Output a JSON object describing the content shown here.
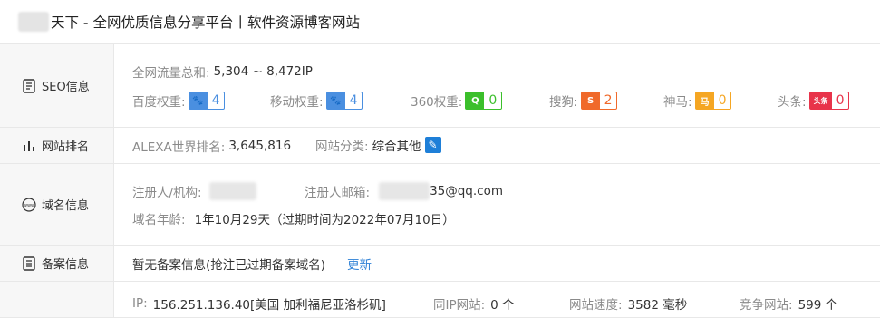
{
  "page": {
    "title": "天下 - 全网优质信息分享平台丨软件资源博客网站"
  },
  "seo": {
    "label": "SEO信息",
    "traffic_label": "全网流量总和:",
    "traffic_value": "5,304 ~ 8,472IP",
    "ranks": [
      {
        "label": "百度权重:",
        "value": "4",
        "icon": "baidu-paw-icon",
        "color": "#4a8fe0",
        "icon_text": "🐾"
      },
      {
        "label": "移动权重:",
        "value": "4",
        "icon": "baidu-mobile-paw-icon",
        "color": "#4a8fe0",
        "icon_text": "🐾"
      },
      {
        "label": "360权重:",
        "value": "0",
        "icon": "360-icon",
        "color": "#3bbf2b",
        "icon_text": "Q"
      },
      {
        "label": "搜狗:",
        "value": "2",
        "icon": "sogou-icon",
        "color": "#f0692a",
        "icon_text": "S"
      },
      {
        "label": "神马:",
        "value": "0",
        "icon": "shenma-icon",
        "color": "#f5a623",
        "icon_text": "马"
      },
      {
        "label": "头条:",
        "value": "0",
        "icon": "toutiao-icon",
        "color": "#e8334a",
        "icon_text": "头条"
      }
    ]
  },
  "rank": {
    "label": "网站排名",
    "alexa_label": "ALEXA世界排名:",
    "alexa_value": "3,645,816",
    "category_label": "网站分类:",
    "category_value": "综合其他"
  },
  "domain": {
    "label": "域名信息",
    "registrant_label": "注册人/机构:",
    "email_label": "注册人邮箱:",
    "email_visible": "35@qq.com",
    "age_label": "域名年龄:",
    "age_value": "1年10月29天（过期时间为2022年07月10日）"
  },
  "beian": {
    "label": "备案信息",
    "text": "暂无备案信息(抢注已过期备案域名)",
    "refresh": "更新"
  },
  "ip": {
    "ip_label": "IP:",
    "ip_value": "156.251.136.40[美国 加利福尼亚洛杉矶]",
    "same_ip_label": "同IP网站:",
    "same_ip_value": "0 个",
    "speed_label": "网站速度:",
    "speed_value": "3582 毫秒",
    "compete_label": "竞争网站:",
    "compete_value": "599 个"
  }
}
